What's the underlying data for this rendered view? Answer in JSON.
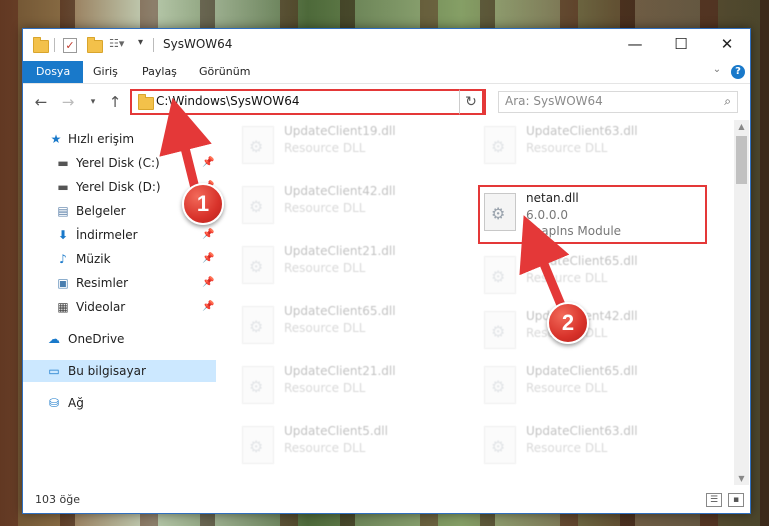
{
  "window": {
    "title": "SysWOW64",
    "controls": {
      "minimize": "—",
      "maximize": "☐",
      "close": "✕"
    }
  },
  "ribbon": {
    "tabs": [
      {
        "label": "Dosya",
        "active": true
      },
      {
        "label": "Giriş"
      },
      {
        "label": "Paylaş"
      },
      {
        "label": "Görünüm"
      }
    ],
    "help": "?"
  },
  "nav": {
    "address": "C:\\Windows\\SysWOW64",
    "search_placeholder": "Ara: SysWOW64"
  },
  "sidebar": {
    "items": [
      {
        "label": "Hızlı erişim",
        "icon": "star-icon",
        "pinned": false
      },
      {
        "label": "Yerel Disk (C:)",
        "icon": "drive-icon",
        "pinned": true
      },
      {
        "label": "Yerel Disk (D:)",
        "icon": "drive-icon",
        "pinned": true
      },
      {
        "label": "Belgeler",
        "icon": "documents-icon",
        "pinned": true
      },
      {
        "label": "İndirmeler",
        "icon": "download-icon",
        "pinned": true
      },
      {
        "label": "Müzik",
        "icon": "music-icon",
        "pinned": true
      },
      {
        "label": "Resimler",
        "icon": "pictures-icon",
        "pinned": true
      },
      {
        "label": "Videolar",
        "icon": "videos-icon",
        "pinned": true
      },
      {
        "label": "OneDrive",
        "icon": "cloud-icon"
      },
      {
        "label": "Bu bilgisayar",
        "icon": "computer-icon",
        "selected": true
      },
      {
        "label": "Ağ",
        "icon": "network-icon"
      }
    ]
  },
  "files": [
    {
      "name": "UpdateClient19.dll",
      "type": "Resource DLL"
    },
    {
      "name": "UpdateClient63.dll",
      "type": "Resource DLL"
    },
    {
      "name": "UpdateClient42.dll",
      "type": "Resource DLL"
    },
    {
      "name": "netan.dll",
      "type": "6.0.0.0",
      "desc": "SnapIns Module"
    },
    {
      "name": "UpdateClient21.dll",
      "type": "Resource DLL"
    },
    {
      "name": "UpdateClient65.dll",
      "type": "Resource DLL"
    },
    {
      "name": "UpdateClient65.dll",
      "type": "Resource DLL"
    },
    {
      "name": "UpdateClient42.dll",
      "type": "Resource DLL"
    },
    {
      "name": "UpdateClient21.dll",
      "type": "Resource DLL"
    },
    {
      "name": "UpdateClient65.dll",
      "type": "Resource DLL"
    },
    {
      "name": "UpdateClient5.dll",
      "type": "Resource DLL"
    },
    {
      "name": "UpdateClient63.dll",
      "type": "Resource DLL"
    }
  ],
  "status": {
    "count": "103 öğe"
  },
  "callouts": {
    "one": "1",
    "two": "2"
  },
  "colors": {
    "accent": "#1979ca",
    "highlight": "#e43838"
  }
}
